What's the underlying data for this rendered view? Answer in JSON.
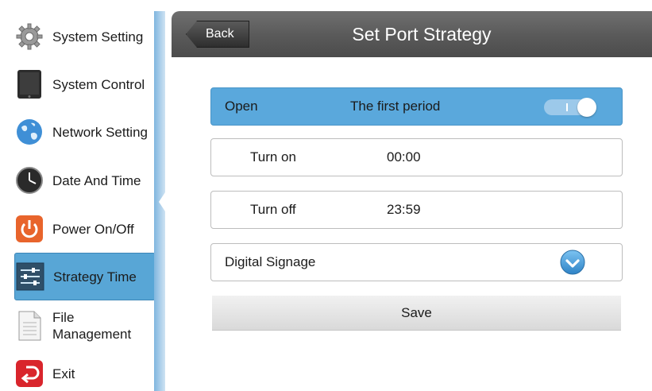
{
  "sidebar": {
    "items": [
      {
        "label": "System Setting",
        "icon": "gear-icon"
      },
      {
        "label": "System Control",
        "icon": "tablet-icon"
      },
      {
        "label": "Network Setting",
        "icon": "globe-icon"
      },
      {
        "label": "Date And Time",
        "icon": "clock-icon"
      },
      {
        "label": "Power On/Off",
        "icon": "power-icon"
      },
      {
        "label": "Strategy Time",
        "icon": "sliders-icon",
        "active": true
      },
      {
        "label_line1": "File",
        "label_line2": "Management",
        "icon": "document-icon"
      },
      {
        "label": "Exit",
        "icon": "exit-icon"
      }
    ]
  },
  "header": {
    "back_label": "Back",
    "title": "Set Port Strategy"
  },
  "form": {
    "open_label": "Open",
    "period_label": "The first period",
    "toggle_on": true,
    "turn_on_label": "Turn on",
    "turn_on_value": "00:00",
    "turn_off_label": "Turn off",
    "turn_off_value": "23:59",
    "signage_label": "Digital Signage",
    "signage_checked": true,
    "save_label": "Save"
  },
  "colors": {
    "accent": "#58a6d6",
    "header_bg": "#5f5f5f",
    "power_orange": "#e8642c",
    "exit_red": "#d9252c"
  }
}
